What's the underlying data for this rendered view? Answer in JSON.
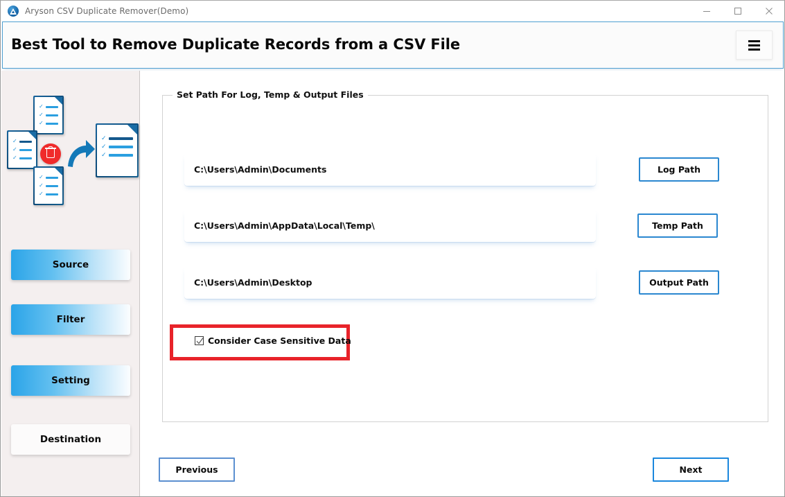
{
  "window": {
    "title": "Aryson CSV Duplicate Remover(Demo)",
    "app_icon": "aryson-logo-icon",
    "controls": [
      {
        "name": "minimize-button",
        "icon": "minimize-icon"
      },
      {
        "name": "maximize-button",
        "icon": "maximize-icon"
      },
      {
        "name": "close-button",
        "icon": "close-icon"
      }
    ]
  },
  "header": {
    "title": "Best Tool to Remove Duplicate Records from a CSV File",
    "menu_icon": "hamburger-menu-icon"
  },
  "sidebar": {
    "illustration": {
      "name": "csv-duplicate-removal-illustration",
      "source_docs": [
        "CSV",
        "CSV",
        "CSV"
      ],
      "output_doc": "CSV",
      "trash_icon": "trash-icon",
      "arrow_icon": "arrow-right-icon"
    },
    "items": [
      {
        "label": "Source",
        "name": "sidebar-item-source",
        "active": true
      },
      {
        "label": "Filter",
        "name": "sidebar-item-filter",
        "active": true
      },
      {
        "label": "Setting",
        "name": "sidebar-item-setting",
        "active": true
      },
      {
        "label": "Destination",
        "name": "sidebar-item-destination",
        "active": false
      }
    ]
  },
  "main": {
    "groupbox_title": "Set Path For Log, Temp & Output Files",
    "paths": [
      {
        "value": "C:\\Users\\Admin\\Documents",
        "placeholder": "C:\\Users\\Admin\\Documents",
        "button_label": "Log Path"
      },
      {
        "value": "C:\\Users\\Admin\\AppData\\Local\\Temp\\",
        "placeholder": "C:\\Users\\Admin\\AppData\\Local\\Temp\\",
        "button_label": "Temp Path"
      },
      {
        "value": "C:\\Users\\Admin\\Desktop",
        "placeholder": "C:\\Users\\Admin\\Desktop",
        "button_label": "Output Path"
      }
    ],
    "checkbox": {
      "label": "Consider Case Sensitive Data",
      "checked": true,
      "highlight_color": "#e8232a"
    }
  },
  "footer": {
    "previous_label": "Previous",
    "next_label": "Next"
  },
  "colors": {
    "accent_blue": "#2a87d0",
    "next_blue": "#1a87dd",
    "header_border": "#4e9fd1",
    "sidebar_bg": "#f4efef",
    "highlight_red": "#e8232a"
  }
}
